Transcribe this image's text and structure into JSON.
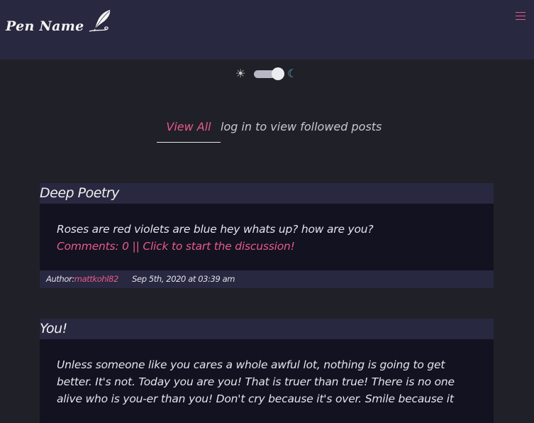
{
  "brand": {
    "name": "Pen Name",
    "icon": "quill-icon"
  },
  "nav": {
    "menu_icon": "hamburger-menu-icon"
  },
  "theme_toggle": {
    "light_icon": "☀",
    "dark_icon": "☾",
    "state": "dark"
  },
  "tabs": {
    "view_all": "View All",
    "followed": "log in to view followed posts"
  },
  "posts": [
    {
      "title": "Deep Poetry",
      "body": "Roses are red violets are blue hey whats up? how are you?",
      "comments": "Comments: 0 || Click to start the discussion!",
      "author_label": "Author:",
      "author": "mattkohl82",
      "date": "Sep 5th, 2020 at 03:39 am"
    },
    {
      "title": "You!",
      "body": "Unless someone like you cares a whole awful lot, nothing is going to get better. It's not. Today you are you! That is truer than true! There is no one alive who is you-er than you! Don't cry because it's over. Smile because it"
    }
  ],
  "colors": {
    "accent": "#e85a8a",
    "navbar": "#282840",
    "background": "#202028",
    "card": "#121220"
  }
}
